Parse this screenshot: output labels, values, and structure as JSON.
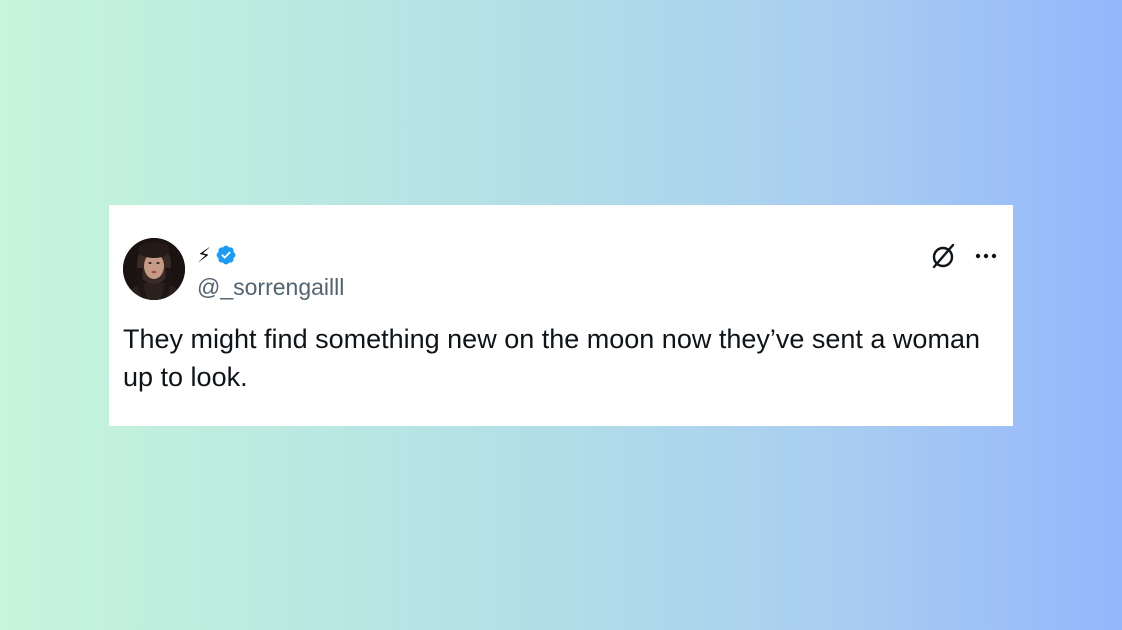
{
  "tweet": {
    "display_name_glyph": "⚡",
    "verified": true,
    "handle": "@_sorrengailll",
    "text": "They might find something new on the moon now they’ve sent a woman up to look."
  },
  "icons": {
    "verified": "verified-badge-icon",
    "x_logo": "x-logo-icon",
    "more": "more-options-icon"
  },
  "colors": {
    "verified_blue": "#1d9bf0",
    "text": "#0f1419",
    "secondary_text": "#536471",
    "background_start": "#c6f5da",
    "background_end": "#94b6fb"
  }
}
